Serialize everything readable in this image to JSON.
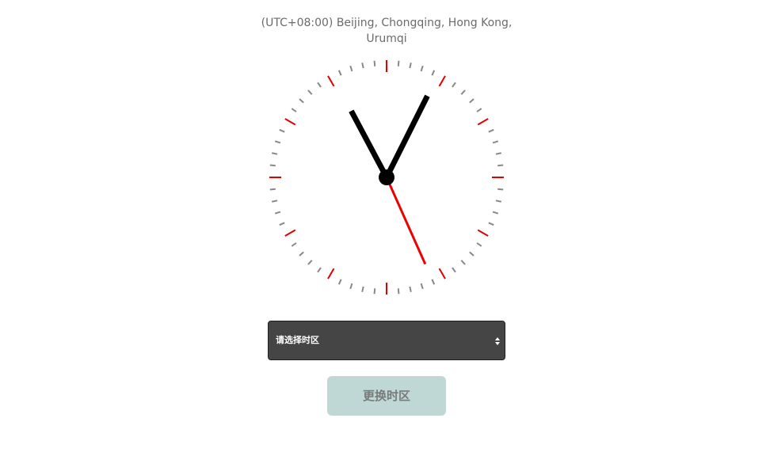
{
  "timezone": {
    "display": "(UTC+08:00) Beijing, Chongqing, Hong Kong, Urumqi"
  },
  "clock": {
    "time": {
      "hour": 11,
      "minute": 4,
      "second": 26
    },
    "colors": {
      "tick": "#888888",
      "major_tick": "#e00000",
      "hand": "#000000",
      "second_hand": "#ee0000"
    }
  },
  "timezone_select": {
    "selected": "请选择时区",
    "icon": "sort-arrows-icon"
  },
  "change_button": {
    "label": "更换时区"
  },
  "colors": {
    "select_bg": "#454545",
    "button_bg": "#bfd8d6",
    "button_text": "#7a7a7a"
  }
}
